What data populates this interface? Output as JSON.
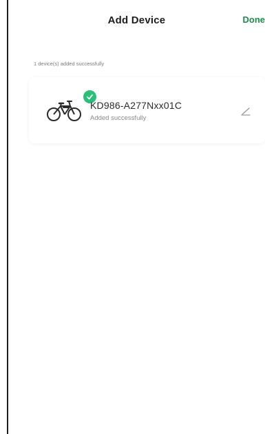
{
  "header": {
    "title": "Add Device",
    "done_label": "Done"
  },
  "status": {
    "message": "1 device(s) added successfully"
  },
  "device": {
    "name": "KD986-A277Nxx01C",
    "status": "Added successfully",
    "icon": "bicycle-icon",
    "badge_icon": "check-icon",
    "edit_icon": "pencil-icon"
  },
  "colors": {
    "accent": "#1f8a4c",
    "badge": "#2bbf79",
    "background": "#ffffff"
  }
}
